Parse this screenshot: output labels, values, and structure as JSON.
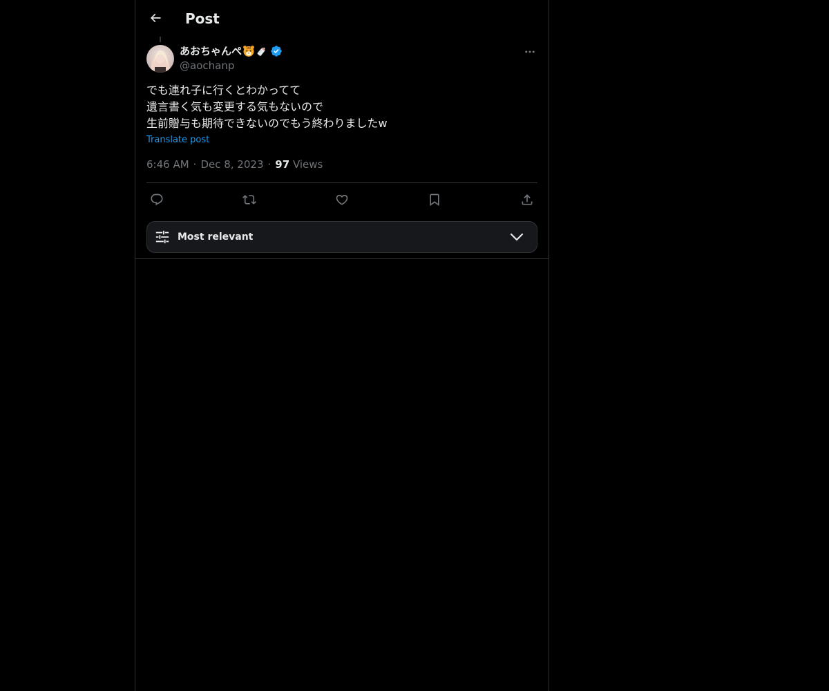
{
  "header": {
    "title": "Post",
    "back_icon": "arrow-left-icon"
  },
  "post": {
    "author": {
      "display_name": "あおちゃんぺ",
      "name_emojis": [
        "tiger-face-emoji",
        "baby-bottle-emoji"
      ],
      "verified": true,
      "handle": "@aochanp"
    },
    "text_lines": [
      "でも連れ子に行くとわかってて",
      "遺言書く気も変更する気もないので",
      "生前贈与も期待できないのでもう終わりましたw"
    ],
    "translate_label": "Translate post",
    "time": "6:46 AM",
    "date": "Dec 8, 2023",
    "views_count": "97",
    "views_label": "Views",
    "separator": "·"
  },
  "actions": [
    {
      "name": "reply",
      "icon": "reply-icon"
    },
    {
      "name": "repost",
      "icon": "repost-icon"
    },
    {
      "name": "like",
      "icon": "heart-icon"
    },
    {
      "name": "bookmark",
      "icon": "bookmark-icon"
    },
    {
      "name": "share",
      "icon": "share-icon"
    }
  ],
  "sort": {
    "label": "Most relevant",
    "icon": "sliders-icon",
    "chevron": "chevron-down-icon"
  },
  "colors": {
    "background": "#000000",
    "text_primary": "#e7e9ea",
    "text_secondary": "#71767b",
    "accent": "#1d9bf0",
    "border": "#2f3336",
    "panel": "#16181c"
  }
}
